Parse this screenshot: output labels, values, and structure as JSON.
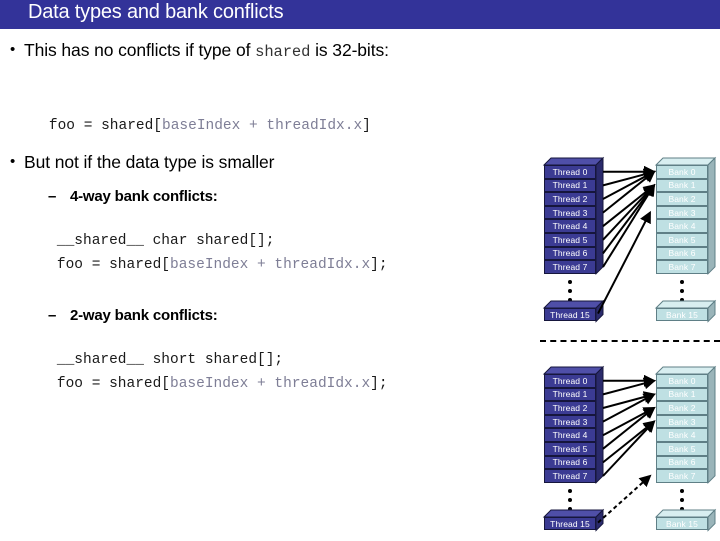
{
  "slide": {
    "title": "Data types and bank conflicts",
    "title_bar_color": "#333399",
    "background_color": "#ffffff"
  },
  "content": {
    "bullet1": {
      "marker": "•",
      "text_before": "This has no conflicts if type of ",
      "code_token": "shared",
      "text_after": " is 32-bits:"
    },
    "code1": {
      "dark_a": "foo = shared[",
      "dim": "baseIndex + threadIdx.x",
      "dark_b": "]"
    },
    "bullet2": {
      "marker": "•",
      "text": "But not if the data type is smaller"
    },
    "sub1": {
      "marker": "–",
      "text": "4-way bank conflicts:"
    },
    "code2a": {
      "dark_a": "__shared__ char shared[];"
    },
    "code2b": {
      "dark_a": "foo = shared[",
      "dim": "baseIndex + threadIdx.x",
      "dark_b": "];"
    },
    "sub2": {
      "marker": "–",
      "text": "2-way bank conflicts:"
    },
    "code3a": {
      "dark_a": "__shared__ short shared[];"
    },
    "code3b": {
      "dark_a": "foo = shared[",
      "dim": "baseIndex + threadIdx.x",
      "dark_b": "];"
    }
  },
  "diagrams": {
    "colors": {
      "thread_fill": "#3b3b93",
      "thread_side": "#2a2a6b",
      "thread_top": "#4f4fa8",
      "bank_fill": "#bfe0e3",
      "bank_side": "#9ab4b9",
      "bank_top": "#d8eef0",
      "arrow": "#000000",
      "label_text": "#ffffff"
    },
    "ellipsis_dots": 3,
    "diagram_4way": {
      "caption_ref": "4-way bank conflicts",
      "threads": [
        "Thread 0",
        "Thread 1",
        "Thread 2",
        "Thread 3",
        "Thread 4",
        "Thread 5",
        "Thread 6",
        "Thread 7"
      ],
      "thread_last": "Thread 15",
      "banks": [
        "Bank 0",
        "Bank 1",
        "Bank 2",
        "Bank 3",
        "Bank 4",
        "Bank 5",
        "Bank 6",
        "Bank 7"
      ],
      "bank_last": "Bank 15",
      "arrow_style": "solid",
      "last_arrow_style": "solid",
      "mapping": [
        {
          "thread": 0,
          "bank": 0
        },
        {
          "thread": 1,
          "bank": 0
        },
        {
          "thread": 2,
          "bank": 0
        },
        {
          "thread": 3,
          "bank": 0
        },
        {
          "thread": 4,
          "bank": 1
        },
        {
          "thread": 5,
          "bank": 1
        },
        {
          "thread": 6,
          "bank": 1
        },
        {
          "thread": 7,
          "bank": 1
        },
        {
          "thread": 15,
          "bank": 3
        }
      ]
    },
    "diagram_2way": {
      "caption_ref": "2-way bank conflicts",
      "threads": [
        "Thread 0",
        "Thread 1",
        "Thread 2",
        "Thread 3",
        "Thread 4",
        "Thread 5",
        "Thread 6",
        "Thread 7"
      ],
      "thread_last": "Thread 15",
      "banks": [
        "Bank 0",
        "Bank 1",
        "Bank 2",
        "Bank 3",
        "Bank 4",
        "Bank 5",
        "Bank 6",
        "Bank 7"
      ],
      "bank_last": "Bank 15",
      "arrow_style": "solid",
      "last_arrow_style": "dashed",
      "mapping": [
        {
          "thread": 0,
          "bank": 0
        },
        {
          "thread": 1,
          "bank": 0
        },
        {
          "thread": 2,
          "bank": 1
        },
        {
          "thread": 3,
          "bank": 1
        },
        {
          "thread": 4,
          "bank": 2
        },
        {
          "thread": 5,
          "bank": 2
        },
        {
          "thread": 6,
          "bank": 3
        },
        {
          "thread": 7,
          "bank": 3
        },
        {
          "thread": 15,
          "bank": 7
        }
      ]
    }
  }
}
